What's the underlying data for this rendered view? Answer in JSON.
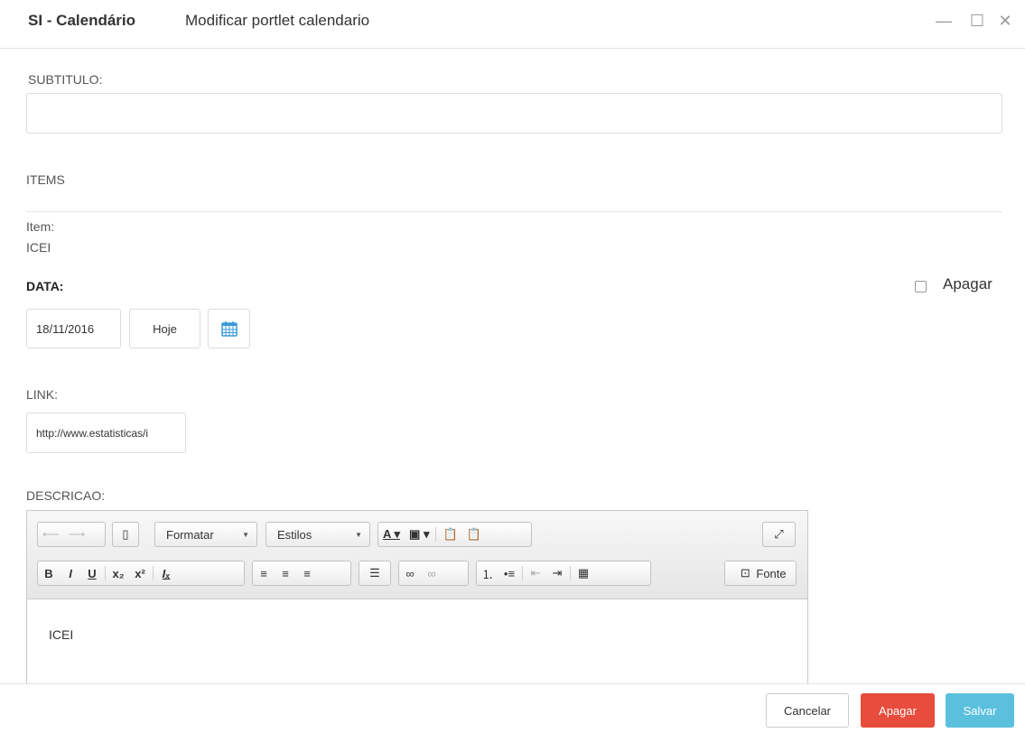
{
  "window": {
    "app_title": "SI - Calendário",
    "subtitle": "Modificar portlet calendario",
    "minimize_glyph": "—",
    "maximize_glyph": "☐",
    "close_glyph": "✕"
  },
  "form": {
    "subtitulo_label": "SUBTITULO:",
    "subtitulo_value": "",
    "items_label": "ITEMS",
    "item_label": "Item:",
    "item_value": "ICEI",
    "data_label": "DATA:",
    "data_value": "18/11/2016",
    "hoje_label": "Hoje",
    "apagar_checkbox_label": "Apagar",
    "link_label": "LINK:",
    "link_value": "http://www.estatisticas/i",
    "descricao_label": "DESCRICAO:"
  },
  "editor": {
    "formatar_label": "Formatar",
    "estilos_label": "Estilos",
    "fonte_label": "Fonte",
    "content_text": "ICEI",
    "icons": [
      "undo-icon",
      "redo-icon",
      "template-icon",
      "font-color-icon",
      "bg-color-icon",
      "paste-text-icon",
      "paste-word-icon",
      "maximize-icon",
      "bold-icon",
      "italic-icon",
      "underline-icon",
      "subscript-icon",
      "superscript-icon",
      "remove-format-icon",
      "align-left-icon",
      "align-center-icon",
      "align-right-icon",
      "justify-icon",
      "link-icon",
      "unlink-icon",
      "numbered-list-icon",
      "bulleted-list-icon",
      "outdent-icon",
      "indent-icon",
      "table-icon",
      "source-icon"
    ]
  },
  "footer": {
    "cancel_label": "Cancelar",
    "delete_label": "Apagar",
    "save_label": "Salvar"
  },
  "colors": {
    "delete_button": "#e74c3c",
    "save_button": "#5bc0de",
    "calendar_icon": "#3a9ad9"
  }
}
